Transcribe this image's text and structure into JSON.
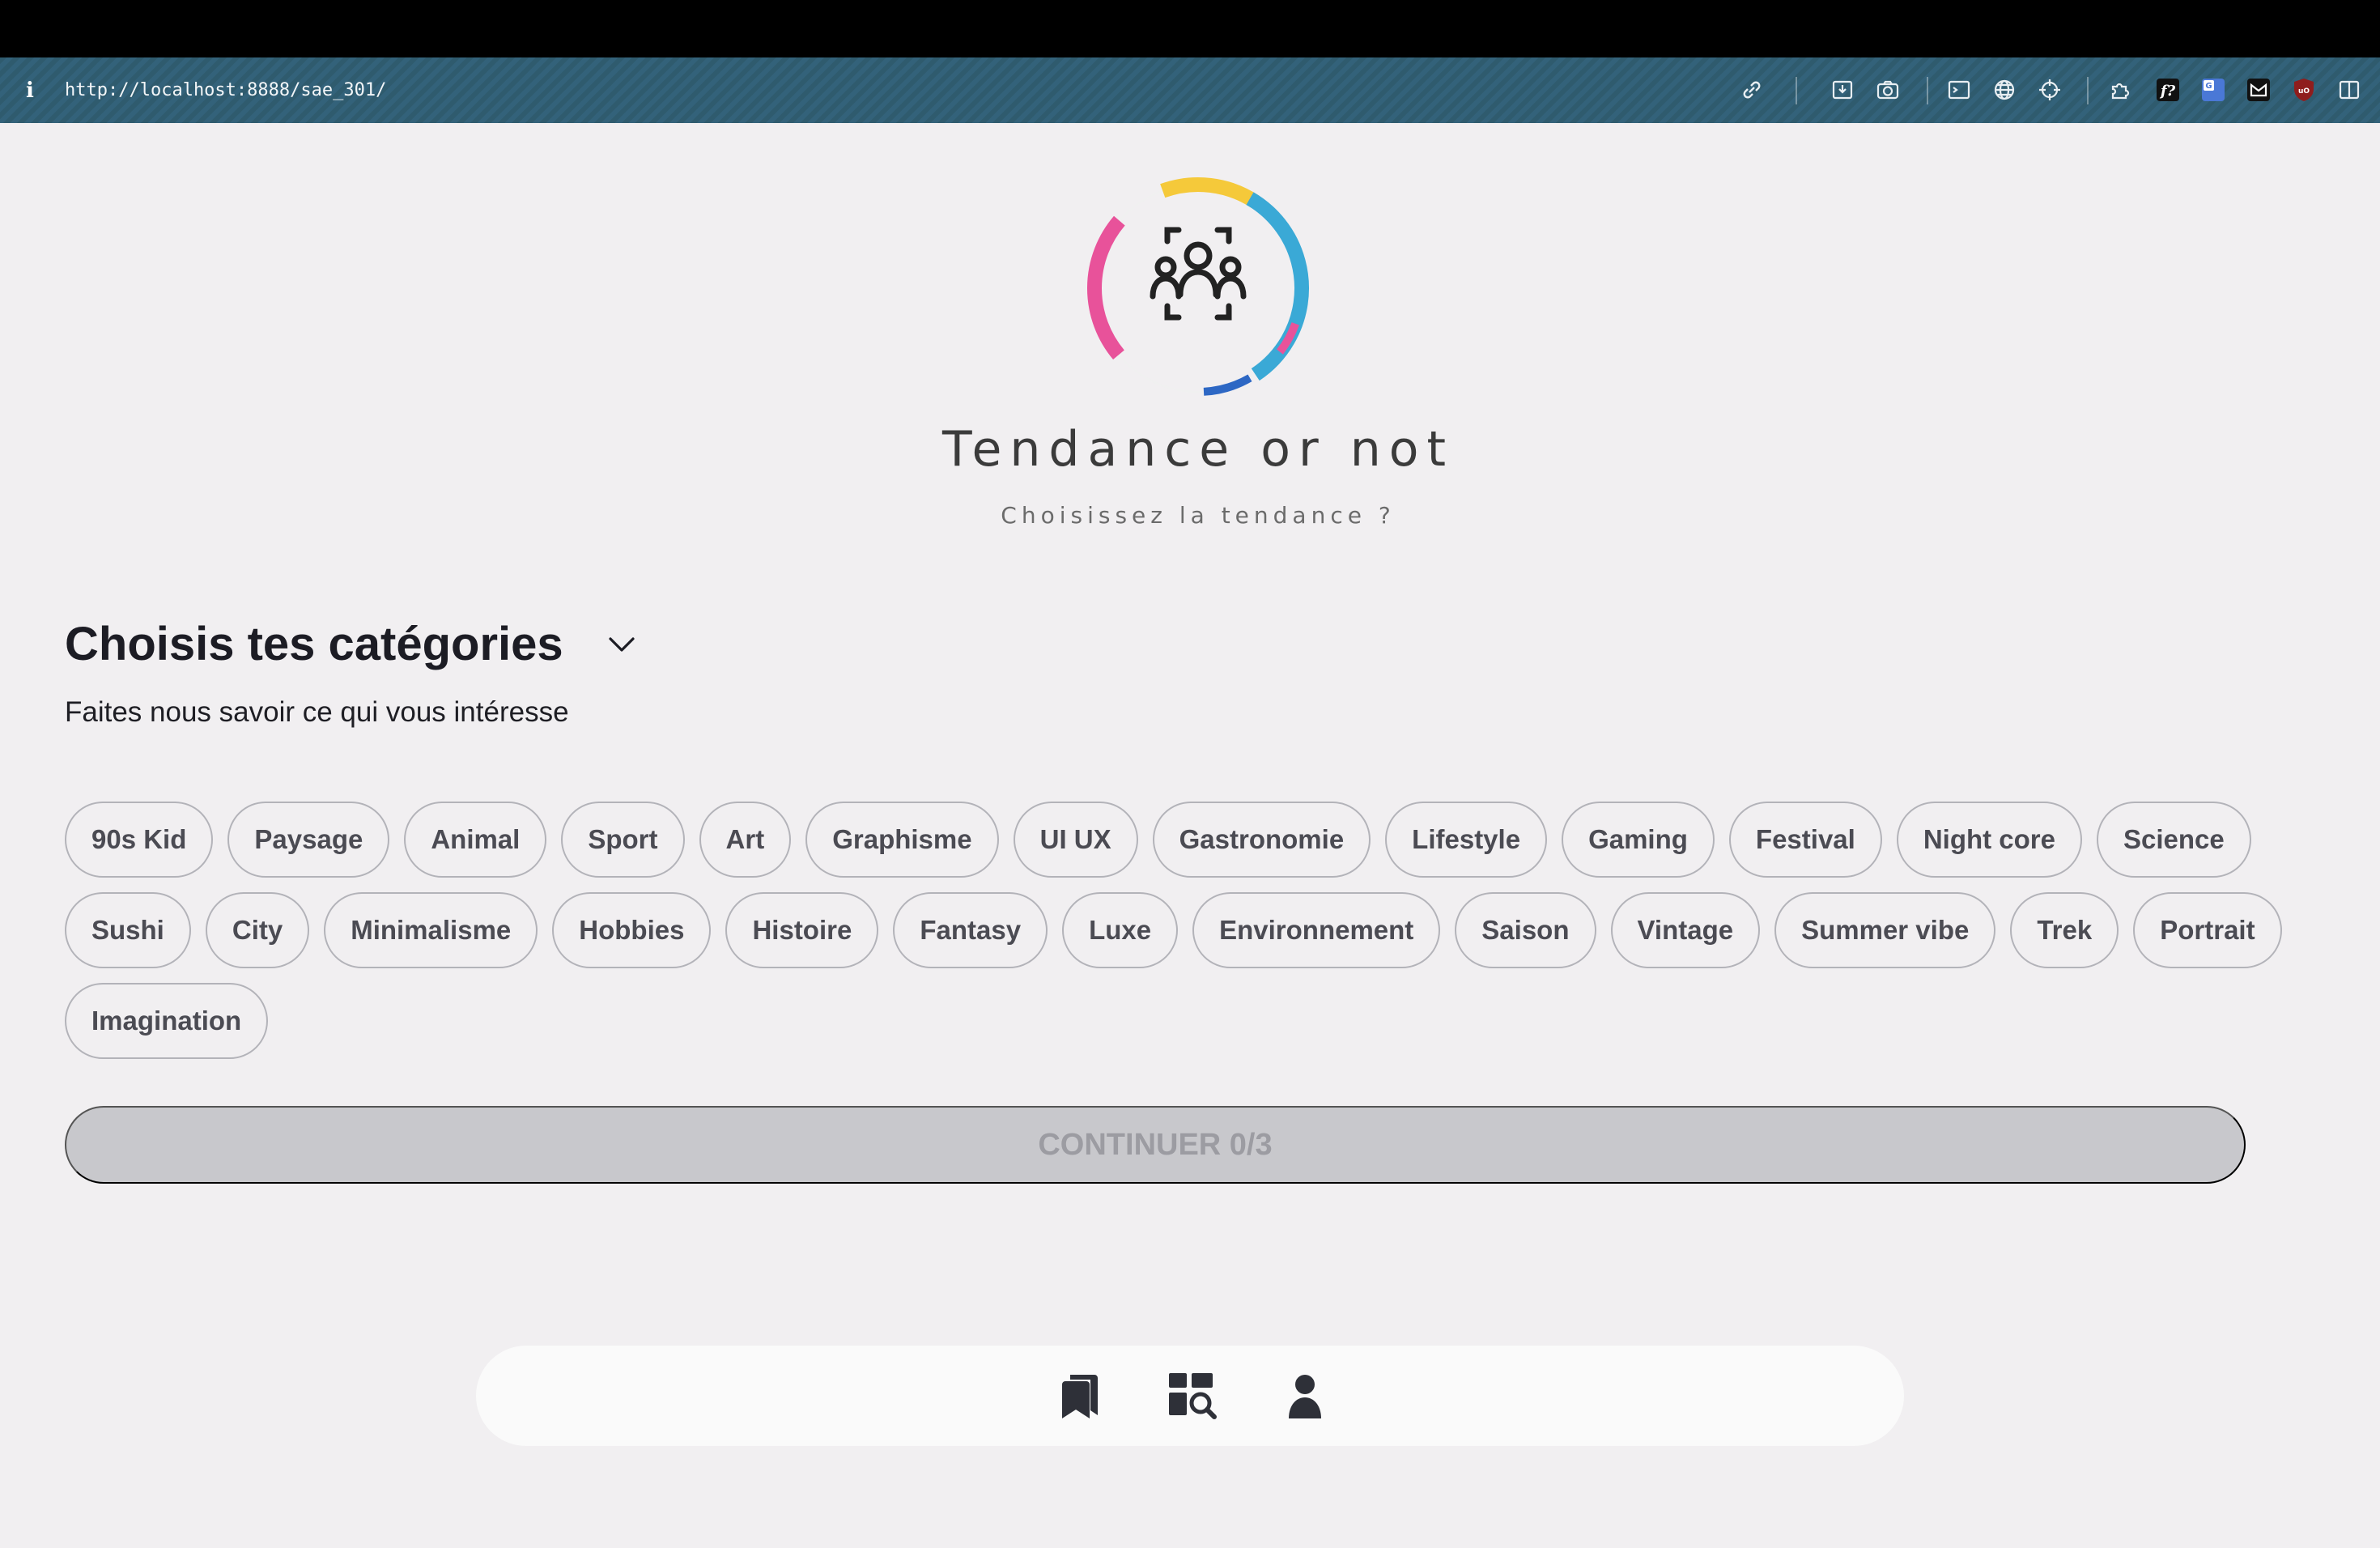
{
  "browser": {
    "info_glyph": "i",
    "url": "http://localhost:8888/sae_301/",
    "toolbar_icons": [
      "link-icon",
      "save-page-icon",
      "camera-icon",
      "terminal-icon",
      "globe-icon",
      "crosshair-icon",
      "extensions-icon",
      "font-icon",
      "translate-icon",
      "mail-icon",
      "ublock-icon",
      "sidebar-icon"
    ]
  },
  "brand": {
    "title": "Tendance or not",
    "tagline": "Choisissez la tendance ?"
  },
  "categories": {
    "heading": "Choisis tes catégories",
    "subheading": "Faites nous savoir ce qui vous intéresse",
    "rows": [
      [
        "90s Kid",
        "Paysage",
        "Animal",
        "Sport",
        "Art",
        "Graphisme",
        "UI UX",
        "Gastronomie",
        "Lifestyle",
        "Gaming",
        "Festival",
        "Night core",
        "Science"
      ],
      [
        "Sushi",
        "City",
        "Minimalisme",
        "Hobbies",
        "Histoire",
        "Fantasy",
        "Luxe",
        "Environnement",
        "Saison",
        "Vintage",
        "Summer vibe",
        "Trek",
        "Portrait"
      ],
      [
        "Imagination"
      ]
    ],
    "continue_label": "CONTINUER 0/3",
    "selected_count": 0,
    "required_count": 3
  },
  "bottom_nav": {
    "items": [
      "bookmarks-icon",
      "dashboard-search-icon",
      "user-icon"
    ]
  },
  "colors": {
    "urlbar": "#2f5b6e",
    "page_background": "#f1eff1",
    "chip_border": "#b3b3b9",
    "button_disabled": "#c8c8cc",
    "button_text_disabled": "#9c9ca2"
  }
}
